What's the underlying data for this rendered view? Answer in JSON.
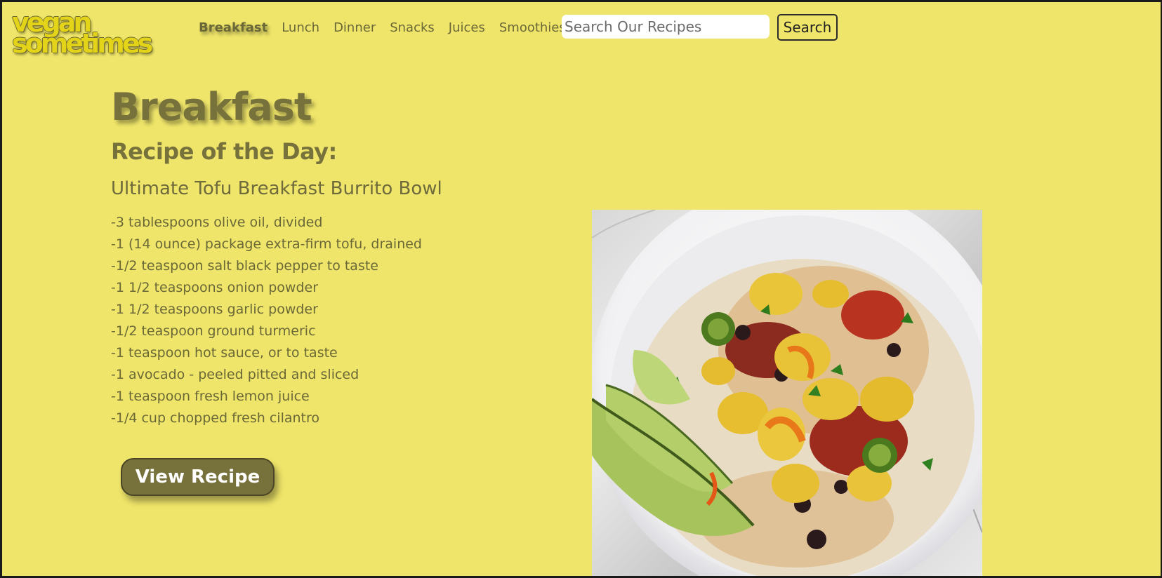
{
  "brand": {
    "logo_line1": "vegan",
    "logo_line2": "sometimes"
  },
  "nav": {
    "items": [
      "Breakfast",
      "Lunch",
      "Dinner",
      "Snacks",
      "Juices",
      "Smoothies"
    ],
    "active": "Breakfast"
  },
  "search": {
    "placeholder": "Search Our Recipes",
    "value": "",
    "button_label": "Search"
  },
  "main": {
    "title": "Breakfast",
    "recipe_heading": "Recipe of the Day:",
    "recipe_name": "Ultimate Tofu Breakfast Burrito Bowl",
    "ingredients": [
      "-3 tablespoons olive oil, divided",
      "-1 (14 ounce) package extra-firm tofu, drained",
      "-1/2 teaspoon salt black pepper to taste",
      "-1 1/2 teaspoons onion powder",
      "-1 1/2 teaspoons garlic powder",
      "-1/2 teaspoon ground turmeric",
      "-1 teaspoon hot sauce, or to taste",
      "-1 avocado - peeled pitted and sliced",
      "-1 teaspoon fresh lemon juice",
      "-1/4 cup chopped fresh cilantro"
    ],
    "view_button_label": "View Recipe"
  },
  "colors": {
    "background": "#efe56a",
    "accent": "#77713b",
    "nav_text": "#6b6838",
    "logo": "#e3d41a"
  },
  "icons": {
    "photo": "tofu-burrito-bowl-photo"
  }
}
